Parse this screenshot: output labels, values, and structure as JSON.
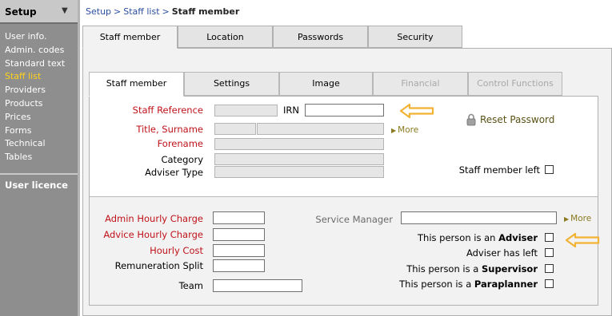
{
  "sidebar": {
    "title": "Setup",
    "items": [
      {
        "label": "User info."
      },
      {
        "label": "Admin. codes"
      },
      {
        "label": "Standard text"
      },
      {
        "label": "Staff list"
      },
      {
        "label": "Providers"
      },
      {
        "label": "Products"
      },
      {
        "label": "Prices"
      },
      {
        "label": "Forms"
      },
      {
        "label": "Technical"
      },
      {
        "label": "Tables"
      }
    ],
    "active_item": "Staff list",
    "licence": "User licence"
  },
  "breadcrumb": {
    "setup": "Setup",
    "separator": ">",
    "staff_list": "Staff list",
    "current": "Staff member"
  },
  "outer_tabs": [
    "Staff member",
    "Location",
    "Passwords",
    "Security"
  ],
  "inner_tabs": [
    "Staff member",
    "Settings",
    "Image",
    "Financial",
    "Control Functions"
  ],
  "form": {
    "staff_reference": "Staff Reference",
    "irn": "IRN",
    "title_surname": "Title, Surname",
    "forename": "Forename",
    "category": "Category",
    "adviser_type": "Adviser Type",
    "more": "More",
    "reset_password": "Reset Password",
    "staff_member_left": "Staff member left"
  },
  "lower": {
    "admin_hourly_charge": "Admin Hourly Charge",
    "advice_hourly_charge": "Advice Hourly Charge",
    "hourly_cost": "Hourly Cost",
    "remuneration_split": "Remuneration Split",
    "team": "Team",
    "service_manager": "Service Manager",
    "more": "More",
    "adviser_prefix": "This person is an",
    "adviser_bold": "Adviser",
    "adviser_has_left": "Adviser has left",
    "supervisor_prefix": "This person is a",
    "supervisor_bold": "Supervisor",
    "paraplanner_prefix": "This person is a",
    "paraplanner_bold": "Paraplanner"
  },
  "colors": {
    "required_label": "#c0121a",
    "active_sidebar": "#ffd21a",
    "arrow": "#f2b233",
    "link": "#2a4ea0"
  }
}
